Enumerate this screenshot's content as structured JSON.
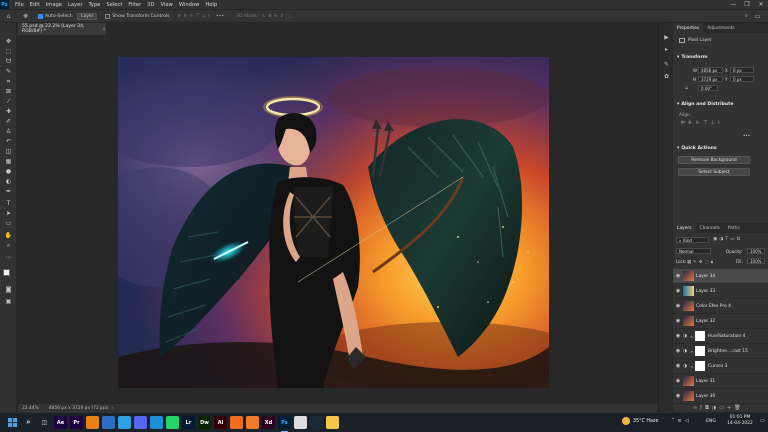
{
  "app": {
    "logo": "Ps",
    "menus": [
      "File",
      "Edit",
      "Image",
      "Layer",
      "Type",
      "Select",
      "Filter",
      "3D",
      "View",
      "Window",
      "Help"
    ],
    "window_controls": [
      "—",
      "❐",
      "✕"
    ]
  },
  "options_bar": {
    "auto_select_label": "Auto-Select:",
    "auto_select_value": "Layer",
    "transform_controls_label": "Show Transform Controls",
    "mode_3d_label": "3D Mode:",
    "more": "•••"
  },
  "document": {
    "tab_title": "55.psd @ 22.2% (Layer 34, RGB/8#) *",
    "close": "×",
    "zoom": "22.44%",
    "dimensions": "4856 px x 3729 px (72 ppi)"
  },
  "properties": {
    "tabs": [
      "Properties",
      "Adjustments"
    ],
    "layer_type": "Pixel Layer",
    "transform_header": "Transform",
    "w_label": "W",
    "w_value": "4856 px",
    "h_label": "H",
    "h_value": "3729 px",
    "x_label": "X",
    "x_value": "0 px",
    "y_label": "Y",
    "y_value": "0 px",
    "angle_value": "0.00°",
    "align_header": "Align and Distribute",
    "align_label": "Align:",
    "more": "•••",
    "quick_actions_header": "Quick Actions",
    "remove_bg": "Remove Background",
    "select_subject": "Select Subject"
  },
  "layers_panel": {
    "tabs": [
      "Layers",
      "Channels",
      "Paths"
    ],
    "filter_value": "Kind",
    "blend_mode": "Normal",
    "opacity_label": "Opacity:",
    "opacity_value": "100%",
    "lock_label": "Lock:",
    "fill_label": "Fill:",
    "fill_value": "100%",
    "layers": [
      {
        "name": "Layer 34",
        "selected": true,
        "kind": "pixel"
      },
      {
        "name": "Layer 33",
        "selected": false,
        "kind": "gradient"
      },
      {
        "name": "Color Efex Pro 4",
        "selected": false,
        "kind": "pixel"
      },
      {
        "name": "Layer 32",
        "selected": false,
        "kind": "pixel"
      },
      {
        "name": "Hue/Saturation 4",
        "selected": false,
        "kind": "adjustment"
      },
      {
        "name": "Brightne....rast 15",
        "selected": false,
        "kind": "adjustment"
      },
      {
        "name": "Curves 3",
        "selected": false,
        "kind": "adjustment"
      },
      {
        "name": "Layer 31",
        "selected": false,
        "kind": "pixel"
      },
      {
        "name": "Layer 30",
        "selected": false,
        "kind": "pixel"
      }
    ]
  },
  "taskbar": {
    "weather": "35°C  Haze",
    "lang": "ENG",
    "time": "01:01 PM",
    "date": "14-04-2022",
    "apps": [
      {
        "name": "start",
        "label": "",
        "color": "#1b2129"
      },
      {
        "name": "search",
        "label": "",
        "color": "#1b2129"
      },
      {
        "name": "task-view",
        "label": "",
        "color": "#1b2129"
      },
      {
        "name": "after-effects",
        "label": "Ae",
        "color": "#1f0040"
      },
      {
        "name": "premiere",
        "label": "Pr",
        "color": "#1f0040"
      },
      {
        "name": "vlc",
        "label": "",
        "color": "#e8811a"
      },
      {
        "name": "photos",
        "label": "",
        "color": "#2b6fc2"
      },
      {
        "name": "telegram",
        "label": "",
        "color": "#2aa3e0"
      },
      {
        "name": "discord",
        "label": "",
        "color": "#5865f2"
      },
      {
        "name": "edge",
        "label": "",
        "color": "#1e8fd6"
      },
      {
        "name": "whatsapp",
        "label": "",
        "color": "#25d366"
      },
      {
        "name": "lightroom",
        "label": "Lr",
        "color": "#001a33"
      },
      {
        "name": "dreamweaver",
        "label": "Dw",
        "color": "#072401"
      },
      {
        "name": "illustrator",
        "label": "Ai",
        "color": "#330000"
      },
      {
        "name": "app-orange",
        "label": "",
        "color": "#ef6c20"
      },
      {
        "name": "app-orange-2",
        "label": "",
        "color": "#f07b2a"
      },
      {
        "name": "xd",
        "label": "Xd",
        "color": "#2e001f"
      },
      {
        "name": "photoshop",
        "label": "Ps",
        "color": "#001e36"
      },
      {
        "name": "chrome",
        "label": "",
        "color": "#dddddd"
      },
      {
        "name": "steam",
        "label": "",
        "color": "#1b2838"
      },
      {
        "name": "explorer",
        "label": "",
        "color": "#f5c84c"
      }
    ]
  },
  "colors": {
    "accent": "#31a8ff",
    "panel_bg": "#323232",
    "canvas_bg": "#282828"
  }
}
